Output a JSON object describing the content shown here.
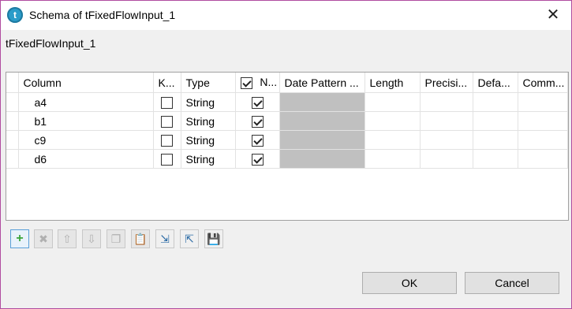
{
  "window": {
    "title": "Schema of tFixedFlowInput_1",
    "close_icon": "close-icon",
    "app_icon_letter": "t"
  },
  "component_name": "tFixedFlowInput_1",
  "table": {
    "headers": {
      "column": "Column",
      "key": "K...",
      "type": "Type",
      "nullable": "N...",
      "date_pattern": "Date Pattern ...",
      "length": "Length",
      "precision": "Precisi...",
      "default": "Defa...",
      "comment": "Comm..."
    },
    "nullable_header_checked": true,
    "rows": [
      {
        "column": "a4",
        "key": false,
        "type": "String",
        "nullable": true,
        "date_pattern": "",
        "length": "",
        "precision": "",
        "default": "",
        "comment": ""
      },
      {
        "column": "b1",
        "key": false,
        "type": "String",
        "nullable": true,
        "date_pattern": "",
        "length": "",
        "precision": "",
        "default": "",
        "comment": ""
      },
      {
        "column": "c9",
        "key": false,
        "type": "String",
        "nullable": true,
        "date_pattern": "",
        "length": "",
        "precision": "",
        "default": "",
        "comment": ""
      },
      {
        "column": "d6",
        "key": false,
        "type": "String",
        "nullable": true,
        "date_pattern": "",
        "length": "",
        "precision": "",
        "default": "",
        "comment": ""
      }
    ]
  },
  "toolbar": [
    {
      "name": "add-row-button",
      "icon": "plus-icon",
      "glyph": "+",
      "enabled": true
    },
    {
      "name": "remove-row-button",
      "icon": "delete-icon",
      "glyph": "✖",
      "enabled": false
    },
    {
      "name": "move-up-button",
      "icon": "arrow-up-icon",
      "glyph": "⇧",
      "enabled": false
    },
    {
      "name": "move-down-button",
      "icon": "arrow-down-icon",
      "glyph": "⇩",
      "enabled": false
    },
    {
      "name": "copy-button",
      "icon": "copy-icon",
      "glyph": "❐",
      "enabled": false
    },
    {
      "name": "paste-button",
      "icon": "paste-icon",
      "glyph": "📋",
      "enabled": false
    },
    {
      "name": "import-schema-button",
      "icon": "import-icon",
      "glyph": "⇲",
      "enabled": true
    },
    {
      "name": "export-schema-button",
      "icon": "export-icon",
      "glyph": "⇱",
      "enabled": true
    },
    {
      "name": "save-schema-button",
      "icon": "save-icon",
      "glyph": "💾",
      "enabled": true
    }
  ],
  "buttons": {
    "ok": "OK",
    "cancel": "Cancel"
  }
}
